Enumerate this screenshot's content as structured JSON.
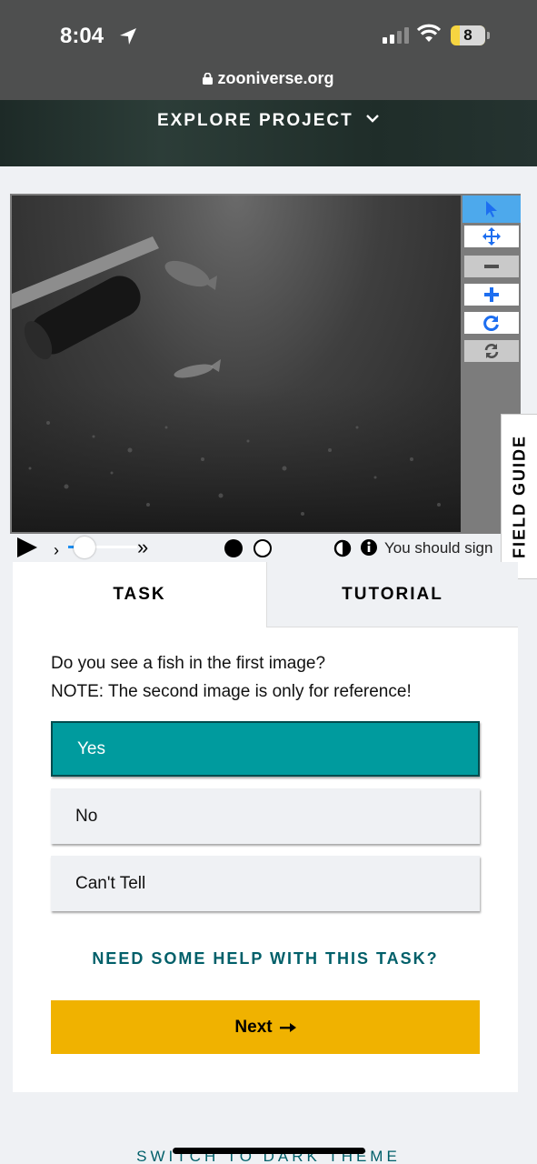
{
  "status_bar": {
    "time": "8:04",
    "battery": "8",
    "location_icon": "location-arrow-icon",
    "wifi_icon": "wifi-icon"
  },
  "browser": {
    "url": "zooniverse.org",
    "lock_icon": "lock-icon"
  },
  "header": {
    "explore_label": "EXPLORE PROJECT",
    "chevron_icon": "chevron-down-icon"
  },
  "viewer": {
    "toolbar": [
      "pointer-icon",
      "move-icon",
      "zoom-out-icon",
      "zoom-in-icon",
      "rotate-icon",
      "reset-icon"
    ],
    "field_guide_label": "FIELD GUIDE"
  },
  "player": {
    "play_icon": "play-icon",
    "speed_slider_level": 0.24,
    "frames": [
      "frame-1",
      "frame-2"
    ],
    "sign_in_text": "You should sign"
  },
  "task": {
    "tabs": {
      "task": "TASK",
      "tutorial": "TUTORIAL"
    },
    "question_line1": "Do you see a fish in the first image?",
    "question_line2": "NOTE: The second image is only for reference!",
    "answers": [
      {
        "label": "Yes",
        "selected": true
      },
      {
        "label": "No",
        "selected": false
      },
      {
        "label": "Can't Tell",
        "selected": false
      }
    ],
    "help_link": "NEED SOME HELP WITH THIS TASK?",
    "next_label": "Next"
  },
  "footer": {
    "dark_theme_link": "SWITCH TO DARK THEME"
  },
  "colors": {
    "selected_answer": "#009b9e",
    "next_button": "#f0b200",
    "link_teal": "#005f69",
    "tool_active": "#4da9ec"
  }
}
